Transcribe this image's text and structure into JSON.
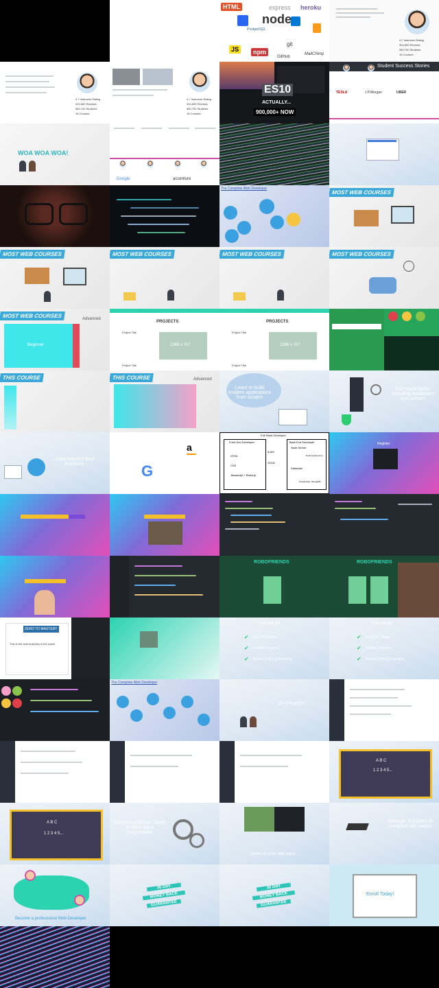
{
  "tiles": {
    "t2_logos": [
      "HTML",
      "express",
      "heroku",
      "node",
      "PostgreSQL",
      "JS",
      "npm",
      "git",
      "GitHub",
      "MailChimp"
    ],
    "profile_stats": [
      "4.7 Instructor Rating",
      "304,669 Reviews",
      "580,700 Students",
      "16 Courses"
    ],
    "es10": {
      "title": "ES10",
      "sub1": "ACTUALLY...",
      "sub2": "900,000+ NOW"
    },
    "student_stories": "Student Success Stories",
    "company_logos": [
      "TESLA",
      "J.P.Morgan",
      "UBER"
    ],
    "woa": "WOA WOA WOA!",
    "story_companies": [
      "Google",
      "accenture"
    ],
    "complete_web_dev": "The Complete Web Developer",
    "most_web_courses": "MOST WEB COURSES",
    "advanced": "Advanced",
    "beginner": "Beginner",
    "projects": "PROJECTS",
    "project_title": "Project Title",
    "project_size": "1366 x 767",
    "this_course": "THIS COURSE",
    "learn_modern": "Learn to build modern applications from scratch",
    "full_stack": "Full Stack Skills: including databases and servers",
    "best_practices": "Learn industry best practices",
    "diagram": {
      "title": "Full Stack Developer",
      "front": "Front End Developer",
      "back": "Back End Developer",
      "html": "HTML",
      "css": "CSS",
      "js": "Javascript + React.js",
      "ajax": "AJAX",
      "json": "JSON",
      "node_server": "Node Server",
      "node_express": "Node.js Express.js",
      "database": "Database",
      "db_names": "PostgreSQL, MongoDB"
    },
    "registered": "Register",
    "robofriends": "ROBOFRIENDS",
    "zero_mastery": "ZERO TO MASTERY",
    "best_business": "This is the best business in the world!",
    "you_will_get": "You will get",
    "get_items": [
      "100+ HD Videos",
      "Portfolio Projects",
      "Private Online Community"
    ],
    "ten_projects": "10+ Projects!",
    "abc": "A B C",
    "nums": "1 2 3 4 5...",
    "no_memorization": "No memorization. Learn to think like a programmer",
    "own_pace": "Learn on your own pace",
    "average": "Average: 3 months to complete the course",
    "professional": "Become a professional Web Developer",
    "money_back": [
      "30 DAY",
      "MONEY BACK",
      "GUARANTEE"
    ],
    "enroll": "Enroll Today!"
  }
}
